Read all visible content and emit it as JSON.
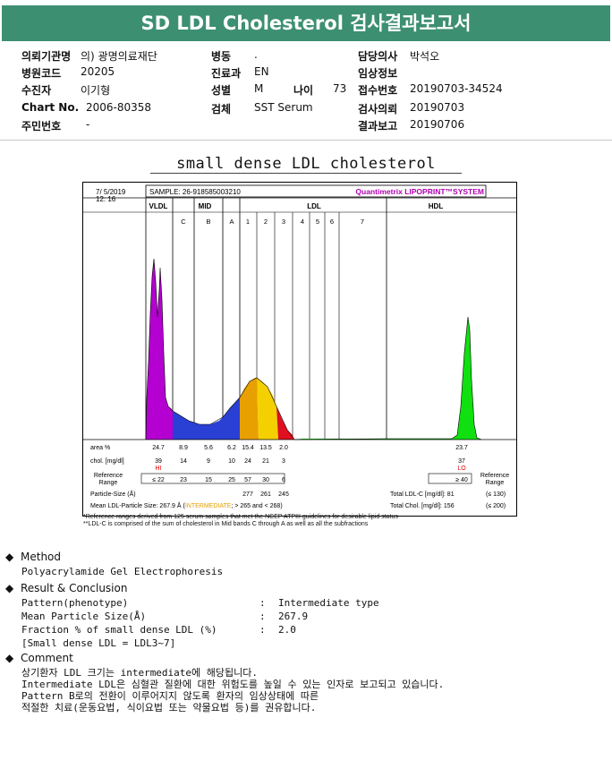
{
  "title": "SD LDL Cholesterol 검사결과보고서",
  "info": {
    "col1": [
      {
        "label": "의뢰기관명",
        "value": "의) 광명의료재단"
      },
      {
        "label": "병원코드",
        "value": "20205"
      },
      {
        "label": "수진자",
        "value": "이기형"
      },
      {
        "label": "Chart No.",
        "value": "2006-80358"
      },
      {
        "label": "주민번호",
        "value": "-"
      }
    ],
    "col2": [
      {
        "label": "병동",
        "value": "."
      },
      {
        "label": "진료과",
        "value": "EN"
      },
      {
        "label": "성별",
        "value": "M"
      },
      {
        "label": "검체",
        "value": "SST Serum"
      }
    ],
    "age_label": "나이",
    "age_value": "73",
    "col3": [
      {
        "label": "담당의사",
        "value": "박석오"
      },
      {
        "label": "임상정보",
        "value": ""
      },
      {
        "label": "접수번호",
        "value": "20190703-34524"
      },
      {
        "label": "검사의뢰",
        "value": "20190703"
      },
      {
        "label": "결과보고",
        "value": "20190706"
      }
    ]
  },
  "section_title": "small dense LDL cholesterol",
  "chart_data": {
    "type": "area",
    "date": "7/ 5/2019",
    "time": "12: 16",
    "sample": "SAMPLE:  26-918585003210",
    "brand": "Quantimetrix LIPOPRINT™SYSTEM",
    "groups": [
      "VLDL",
      "MID",
      "LDL",
      "HDL"
    ],
    "bands": [
      "C",
      "B",
      "A",
      "1",
      "2",
      "3",
      "4",
      "5",
      "6",
      "7"
    ],
    "colors": {
      "vldl": "#b400d0",
      "mid": "#2a3fd4",
      "ldl1": "#e8a000",
      "ldl2": "#f4d000",
      "ldl3": "#e01020",
      "hdl": "#10e010"
    },
    "area_label": "area %",
    "area_values": [
      "24.7",
      "8.9",
      "5.6",
      "6.2",
      "15.4",
      "13.5",
      "2.0",
      "23.7"
    ],
    "chol_label": "chol. [mg/dl]",
    "chol_values": [
      "39",
      "14",
      "9",
      "10",
      "24",
      "21",
      "3",
      "37"
    ],
    "chol_flags": {
      "vldl": "HI",
      "hdl": "LO"
    },
    "ref_label_1": "Reference",
    "ref_label_2": "Range",
    "ref_values": [
      "≤ 22",
      "23",
      "15",
      "25",
      "57",
      "30",
      "6"
    ],
    "ref_hdl": "≥ 40",
    "ref_right_1": "Reference",
    "ref_right_2": "Range",
    "particle_size_label": "Particle-Size (Å)",
    "particle_sizes": [
      "277",
      "261",
      "245"
    ],
    "total_ldl_label": "Total LDL-C [mg/dl]:  81",
    "total_ldl_range": "(≤ 130)",
    "mean_size_prefix": "Mean LDL-Particle Size:   267.9 Å  (",
    "mean_size_class": "INTERMEDIATE",
    "mean_size_suffix": "; > 265 and < 268)",
    "total_chol_label": "Total Chol. [mg/dl]:   156",
    "total_chol_range": "(≤ 200)"
  },
  "footnotes": [
    "*Reference ranges derived from 125 serum samples that met the NCEP ATPIII guidelines for desirable lipid status",
    "**LDL-C is comprised of the sum of cholesterol in Mid bands C through A as well as all the subfractions"
  ],
  "method": {
    "heading": "Method",
    "text": "Polyacrylamide Gel Electrophoresis"
  },
  "result": {
    "heading": "Result & Conclusion",
    "rows": [
      {
        "label": "Pattern(phenotype)",
        "value": "Intermediate type"
      },
      {
        "label": "Mean Particle Size(Å)",
        "value": "267.9"
      },
      {
        "label": "Fraction % of small dense LDL (%)",
        "value": "2.0"
      }
    ],
    "note": "[Small dense LDL = LDL3~7]"
  },
  "comment": {
    "heading": "Comment",
    "lines": [
      "상기환자 LDL 크기는 intermediate에 해당됩니다.",
      "Intermediate LDL은 심혈관 질환에 대한 위험도를 높일 수 있는 인자로 보고되고 있습니다.",
      "Pattern B로의 전환이 이루어지지 않도록 환자의 임상상태에 따른",
      "적절한 치료(운동요법, 식이요법 또는 약물요법 등)를 권유합니다."
    ]
  }
}
